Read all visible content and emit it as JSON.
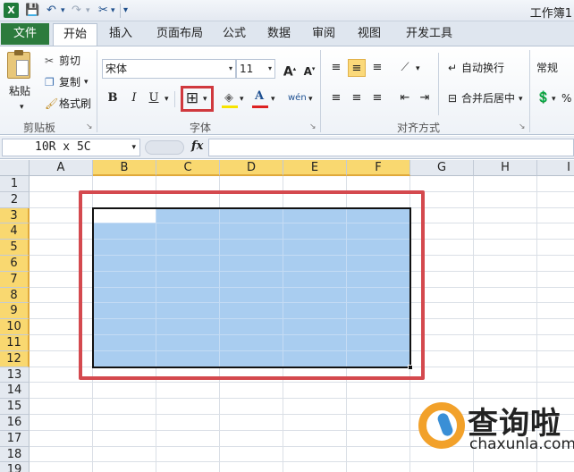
{
  "titlebar": {
    "app_icon": "excel-icon",
    "title": "工作簿1"
  },
  "tabs": {
    "file": "文件",
    "items": [
      "开始",
      "插入",
      "页面布局",
      "公式",
      "数据",
      "审阅",
      "视图",
      "开发工具"
    ],
    "active": "开始"
  },
  "ribbon": {
    "clipboard": {
      "paste": "粘贴",
      "cut": "剪切",
      "copy": "复制",
      "format_painter": "格式刷",
      "label": "剪贴板"
    },
    "font": {
      "font_name": "宋体",
      "font_size": "11",
      "bold": "B",
      "italic": "I",
      "underline": "U",
      "increase": "A",
      "decrease": "A",
      "phonetic": "wén",
      "label": "字体"
    },
    "alignment": {
      "wrap_text": "自动换行",
      "merge_center": "合并后居中",
      "label": "对齐方式"
    },
    "number": {
      "format": "常规",
      "percent": "%"
    }
  },
  "formula_bar": {
    "name_box": "10R x 5C",
    "fx": "fx",
    "value": ""
  },
  "grid": {
    "columns": [
      "A",
      "B",
      "C",
      "D",
      "E",
      "F",
      "G",
      "H",
      "I"
    ],
    "rows": [
      "1",
      "2",
      "3",
      "4",
      "5",
      "6",
      "7",
      "8",
      "9",
      "10",
      "11",
      "12",
      "13",
      "14",
      "15",
      "16",
      "17",
      "18",
      "19"
    ],
    "selected_columns": [
      "B",
      "C",
      "D",
      "E",
      "F"
    ],
    "selected_rows": [
      "3",
      "4",
      "5",
      "6",
      "7",
      "8",
      "9",
      "10",
      "11",
      "12"
    ],
    "selection_color": "#a9cdf0",
    "annotation_color": "#d4494e"
  },
  "watermark": {
    "cn": "查询啦",
    "en": "chaxunla.com"
  }
}
